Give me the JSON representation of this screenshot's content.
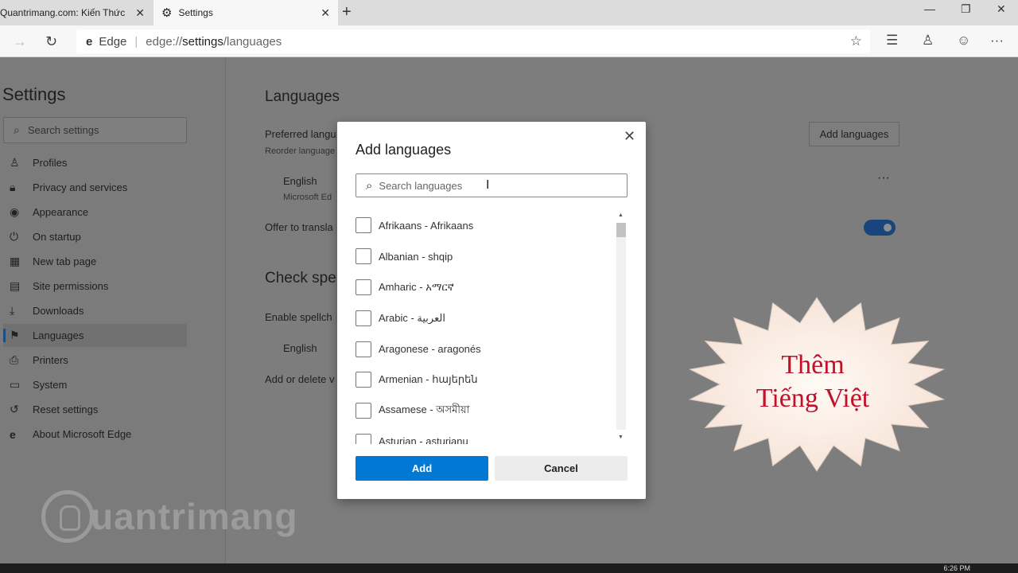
{
  "tabs": [
    {
      "title": "Quantrimang.com: Kiến Thức Cô"
    },
    {
      "title": "Settings"
    }
  ],
  "address": {
    "site_label": "Edge",
    "url_prefix": "edge://",
    "url_main": "settings",
    "url_suffix": "/languages"
  },
  "sidebar": {
    "title": "Settings",
    "search_placeholder": "Search settings",
    "items": [
      {
        "label": "Profiles",
        "icon": "person-icon"
      },
      {
        "label": "Privacy and services",
        "icon": "lock-icon"
      },
      {
        "label": "Appearance",
        "icon": "palette-icon"
      },
      {
        "label": "On startup",
        "icon": "power-icon"
      },
      {
        "label": "New tab page",
        "icon": "grid-icon"
      },
      {
        "label": "Site permissions",
        "icon": "permissions-icon"
      },
      {
        "label": "Downloads",
        "icon": "download-icon"
      },
      {
        "label": "Languages",
        "icon": "languages-icon"
      },
      {
        "label": "Printers",
        "icon": "printer-icon"
      },
      {
        "label": "System",
        "icon": "laptop-icon"
      },
      {
        "label": "Reset settings",
        "icon": "reset-icon"
      },
      {
        "label": "About Microsoft Edge",
        "icon": "edge-icon"
      }
    ],
    "active": "Languages"
  },
  "content": {
    "title": "Languages",
    "preferred_label": "Preferred langu",
    "reorder_text": "Reorder language",
    "add_languages_btn": "Add languages",
    "english_label": "English",
    "english_sub": "Microsoft Ed",
    "offer_translate": "Offer to transla",
    "check_title": "Check spe",
    "enable_spell": "Enable spellch",
    "english2": "English",
    "add_or_delete": "Add or delete v",
    "more": "···"
  },
  "dialog": {
    "title": "Add languages",
    "search_placeholder": "Search languages",
    "languages": [
      "Afrikaans - Afrikaans",
      "Albanian - shqip",
      "Amharic - አማርኛ",
      "Arabic - العربية",
      "Aragonese - aragonés",
      "Armenian - հայերեն",
      "Assamese - অসমীয়া",
      "Asturian - asturianu"
    ],
    "add_btn": "Add",
    "cancel_btn": "Cancel"
  },
  "callout": {
    "line1": "Thêm",
    "line2": "Tiếng Việt"
  },
  "watermark": "uantrimang",
  "taskbar": {
    "time": "6:26 PM"
  },
  "colors": {
    "accent": "#0078d4",
    "callout_text": "#c0102a",
    "burst_fill": "#fbeee6"
  }
}
